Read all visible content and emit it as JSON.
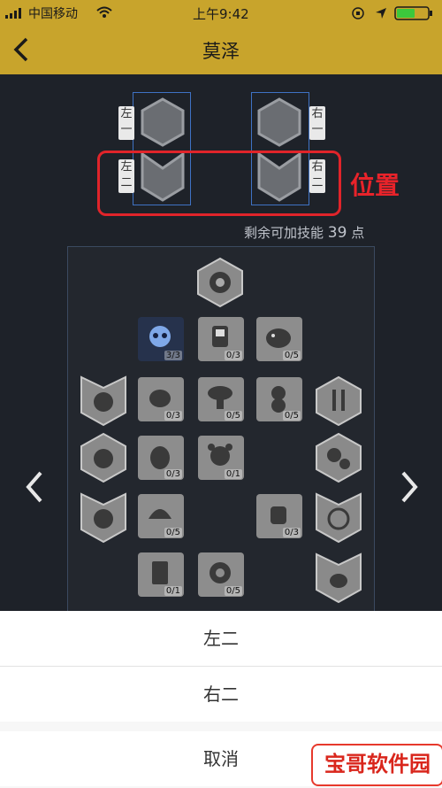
{
  "status_bar": {
    "carrier": "中国移动",
    "time": "上午9:42"
  },
  "nav": {
    "title": "莫泽",
    "back_icon": "chevron-left-icon"
  },
  "slots": {
    "left_top": "左一",
    "left_bottom": "左二",
    "right_top": "右一",
    "right_bottom": "右二"
  },
  "annotation": "位置",
  "remaining": {
    "text": "剩余可加技能",
    "points": "39",
    "unit": "点"
  },
  "skills": [
    {
      "count": "3/3"
    },
    {
      "count": "0/3"
    },
    {
      "count": "0/5"
    },
    {
      "count": "0/3"
    },
    {
      "count": "0/5"
    },
    {
      "count": "0/5"
    },
    {
      "count": "0/3"
    },
    {
      "count": "0/1"
    },
    {
      "count": "0/5"
    },
    {
      "count": "0/3"
    },
    {
      "count": "0/1"
    },
    {
      "count": "0/5"
    }
  ],
  "sheet": {
    "option1": "左二",
    "option2": "右二",
    "cancel": "取消"
  },
  "watermark": "宝哥软件园",
  "colors": {
    "header": "#c8a42c",
    "highlight": "#e0242a",
    "column_border": "#3f72c4"
  }
}
